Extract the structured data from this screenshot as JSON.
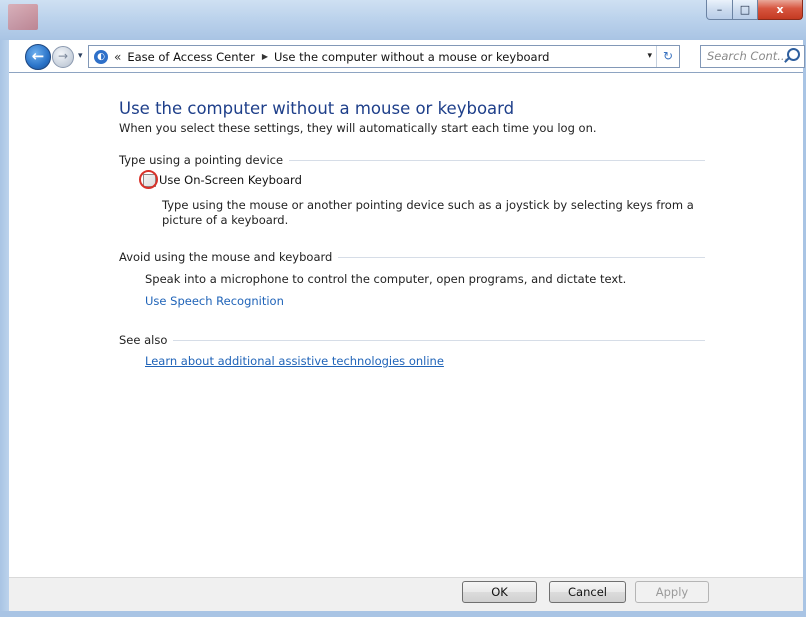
{
  "window": {
    "minimize_glyph": "–",
    "maximize_glyph": "□",
    "close_glyph": "x"
  },
  "nav": {
    "back_glyph": "←",
    "forward_glyph": "→",
    "dropdown_glyph": "▾",
    "address": {
      "overflow": "«",
      "segments": [
        "Ease of Access Center",
        "Use the computer without a mouse or keyboard"
      ],
      "separator_glyph": "▶",
      "dropdown_glyph": "▾",
      "refresh_glyph": "↻"
    },
    "search": {
      "placeholder": "Search Cont..."
    }
  },
  "page": {
    "title": "Use the computer without a mouse or keyboard",
    "subtitle": "When you select these settings, they will automatically start each time you log on.",
    "sections": [
      {
        "heading": "Type using a pointing device",
        "checkbox_label": "Use On-Screen Keyboard",
        "checkbox_checked": false,
        "description": "Type using the mouse or another pointing device such as a joystick by selecting keys from a picture of a keyboard."
      },
      {
        "heading": "Avoid using the mouse and keyboard",
        "description": "Speak into a microphone to control the computer, open programs, and dictate text.",
        "link": "Use Speech Recognition"
      },
      {
        "heading": "See also",
        "link": "Learn about additional assistive technologies online"
      }
    ]
  },
  "buttons": {
    "ok": "OK",
    "cancel": "Cancel",
    "apply": "Apply"
  },
  "colors": {
    "title_blue": "#1e3f8a",
    "link_blue": "#1f63b8",
    "highlight_red": "#d8322a"
  }
}
